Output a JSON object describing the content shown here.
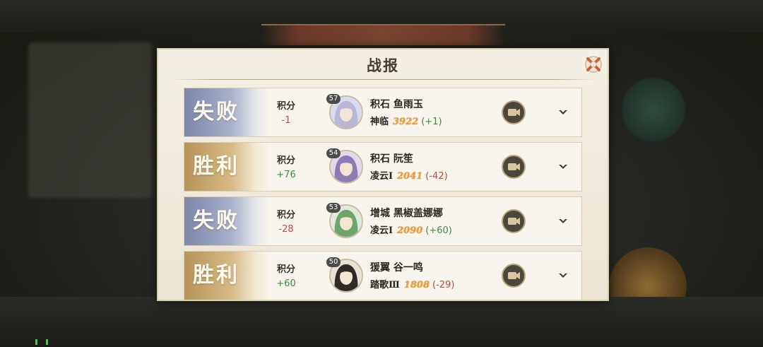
{
  "dialog": {
    "title": "战报",
    "close_icon": "close-icon"
  },
  "records": [
    {
      "result": "失败",
      "outcome": "lose",
      "score_label": "积分",
      "score_delta": "-1",
      "delta_sign": "neg",
      "level": "57",
      "player": "积石 鱼雨玉",
      "rank": "神临",
      "rating": "3922",
      "rating_delta": "(+1)",
      "rating_delta_sign": "pos"
    },
    {
      "result": "胜利",
      "outcome": "win",
      "score_label": "积分",
      "score_delta": "+76",
      "delta_sign": "pos",
      "level": "54",
      "player": "积石 阮笙",
      "rank": "凌云Ⅰ",
      "rating": "2041",
      "rating_delta": "(-42)",
      "rating_delta_sign": "neg"
    },
    {
      "result": "失败",
      "outcome": "lose",
      "score_label": "积分",
      "score_delta": "-28",
      "delta_sign": "neg",
      "level": "53",
      "player": "增城 黑椒盖娜娜",
      "rank": "凌云Ⅰ",
      "rating": "2090",
      "rating_delta": "(+60)",
      "rating_delta_sign": "pos"
    },
    {
      "result": "胜利",
      "outcome": "win",
      "score_label": "积分",
      "score_delta": "+60",
      "delta_sign": "pos",
      "level": "50",
      "player": "猨翼 谷一鸣",
      "rank": "踏歌Ⅲ",
      "rating": "1808",
      "rating_delta": "(-29)",
      "rating_delta_sign": "neg"
    }
  ],
  "icons": {
    "replay": "video-camera-icon",
    "expand": "chevron-down-icon",
    "avatar": "character-portrait"
  },
  "colors": {
    "lose_banner": "#7d86a8",
    "win_banner": "#b6945a",
    "negative": "#c44a3a",
    "positive": "#3c8a3a",
    "rating": "#e9a23a"
  }
}
